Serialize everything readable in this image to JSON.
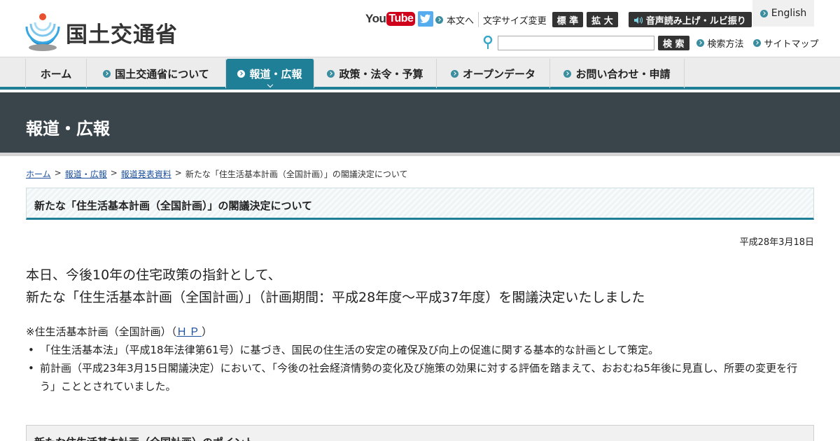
{
  "header": {
    "logo_text": "国土交通省",
    "youtube_text": "You",
    "youtube_tube": "Tube",
    "links": {
      "main_text": "本文へ",
      "font_size_label": "文字サイズ変更",
      "standard": "標 準",
      "enlarge": "拡 大",
      "voice": "音声読み上げ・ルビ振り",
      "english": "English"
    },
    "search": {
      "placeholder": "",
      "button": "検 索",
      "method": "検索方法",
      "sitemap": "サイトマップ"
    }
  },
  "nav": {
    "items": [
      {
        "label": "ホーム"
      },
      {
        "label": "国土交通省について"
      },
      {
        "label": "報道・広報"
      },
      {
        "label": "政策・法令・予算"
      },
      {
        "label": "オープンデータ"
      },
      {
        "label": "お問い合わせ・申請"
      }
    ]
  },
  "banner": {
    "title": "報道・広報"
  },
  "breadcrumb": {
    "home": "ホーム",
    "press": "報道・広報",
    "releases": "報道発表資料",
    "current": "新たな「住生活基本計画（全国計画）」の閣議決定について",
    "sep": ">"
  },
  "article": {
    "title": "新たな「住生活基本計画（全国計画）」の閣議決定について",
    "date": "平成28年3月18日",
    "lead_line1": "本日、今後10年の住宅政策の指針として、",
    "lead_line2": "新たな「住生活基本計画（全国計画）」（計画期間：平成28年度～平成37年度）を閣議決定いたしました",
    "note_prefix": "※住生活基本計画（全国計画）（",
    "note_link": "ＨＰ",
    "note_suffix": "）",
    "bullets": [
      "「住生活基本法」（平成18年法律第61号）に基づき、国民の住生活の安定の確保及び向上の促進に関する基本的な計画として策定。",
      "前計画（平成23年3月15日閣議決定）において、「今後の社会経済情勢の変化及び施策の効果に対する評価を踏まえて、おおむね5年後に見直し、所要の変更を行う」こととされていました。"
    ],
    "points_title": "新たな住生活基本計画（全国計画）のポイント"
  }
}
